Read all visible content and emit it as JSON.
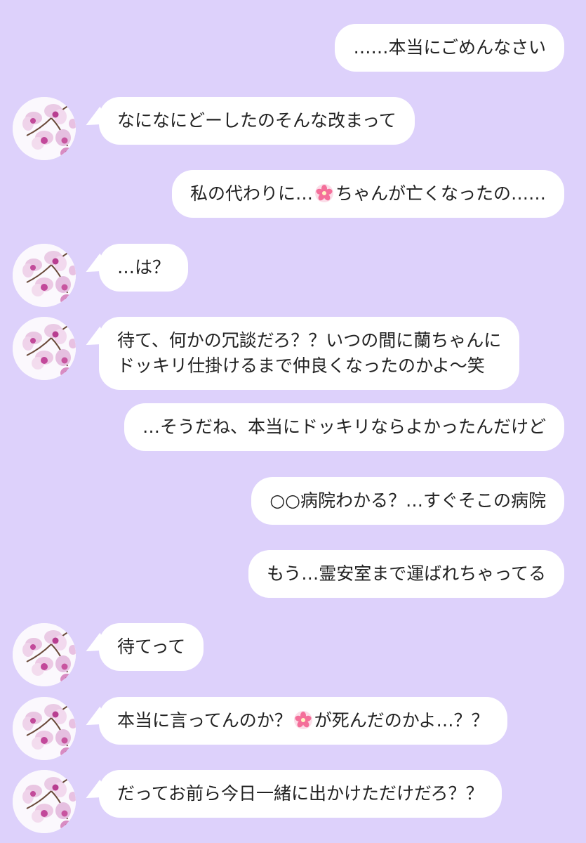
{
  "messages": [
    {
      "side": "right",
      "text": "……本当にごめんなさい"
    },
    {
      "side": "left",
      "text": "なになにどーしたのそんな改まって"
    },
    {
      "side": "right",
      "text_before": "私の代わりに…",
      "icon": "sakura-icon",
      "text_after": "ちゃんが亡くなったの……"
    },
    {
      "side": "left",
      "text": "…は？"
    },
    {
      "side": "left",
      "line1": "待て、何かの冗談だろ？？いつの間に蘭ちゃんに",
      "line2": "ドッキリ仕掛けるまで仲良くなったのかよ〜笑"
    },
    {
      "side": "right",
      "text": "…そうだね、本当にドッキリならよかったんだけど"
    },
    {
      "side": "right",
      "text": "○○病院わかる？…すぐそこの病院"
    },
    {
      "side": "right",
      "text": "もう…霊安室まで運ばれちゃってる"
    },
    {
      "side": "left",
      "text": "待てって"
    },
    {
      "side": "left",
      "text_before": "本当に言ってんのか？",
      "icon": "sakura-icon",
      "text_after": "が死んだのかよ…？？"
    },
    {
      "side": "left",
      "text": "だってお前ら今日一緒に出かけただけだろ？？"
    }
  ],
  "avatar": {
    "icon": "orchid-avatar-icon"
  },
  "colors": {
    "background": "#ddd1fb",
    "bubble": "#ffffff",
    "text": "#222222"
  }
}
